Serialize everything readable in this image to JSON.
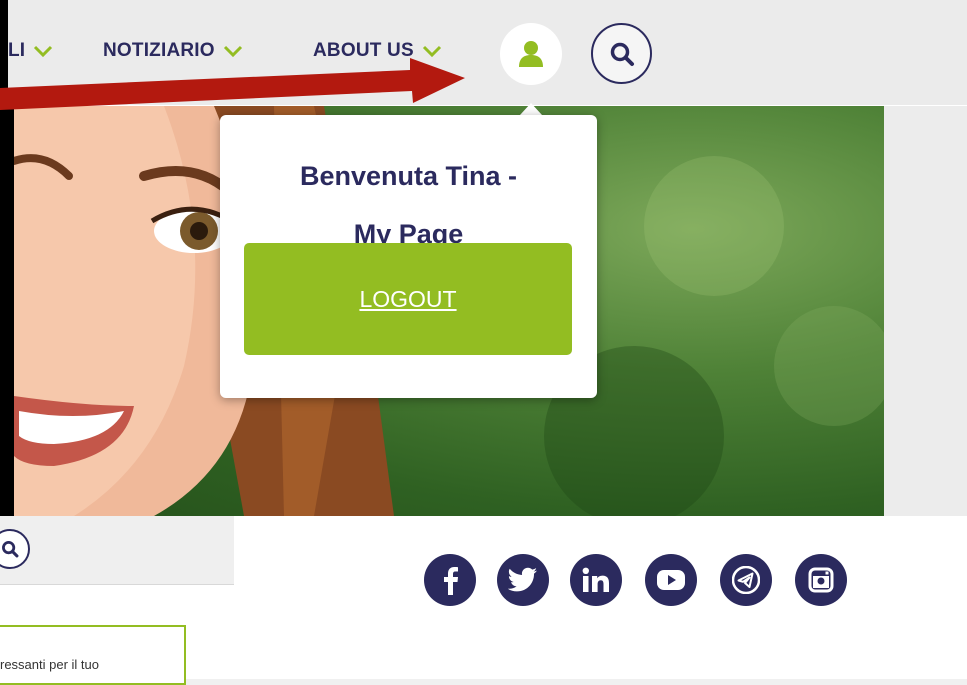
{
  "nav": {
    "items": [
      {
        "label": "LI"
      },
      {
        "label": "NOTIZIARIO"
      },
      {
        "label": "ABOUT US"
      }
    ],
    "user_icon": "user-icon",
    "search_icon": "search-icon"
  },
  "popup": {
    "greeting": "Benvenuta Tina -",
    "my_page": "My Page",
    "logout_label": "LOGOUT"
  },
  "bottom": {
    "search_icon": "search-icon",
    "info_snippet": "ressanti per il tuo"
  },
  "social": [
    {
      "icon": "facebook-icon"
    },
    {
      "icon": "twitter-icon"
    },
    {
      "icon": "linkedin-icon"
    },
    {
      "icon": "youtube-icon"
    },
    {
      "icon": "telegram-icon"
    },
    {
      "icon": "instagram-icon"
    }
  ],
  "colors": {
    "brand_navy": "#2b2a5e",
    "accent_green": "#93bd22",
    "annotation_red": "#b3190f"
  }
}
